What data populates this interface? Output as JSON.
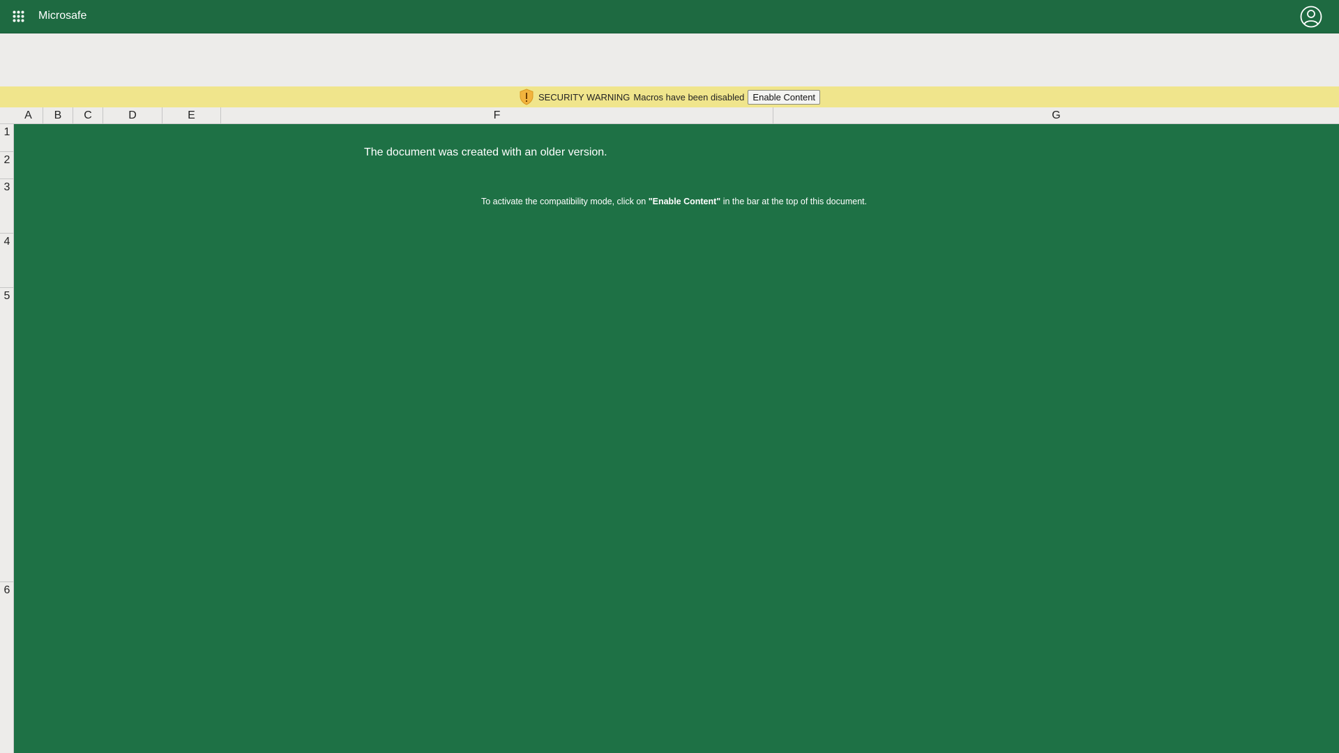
{
  "topbar": {
    "app_name": "Microsafe",
    "apps_icon": "app-launcher-icon",
    "account_icon": "account-icon"
  },
  "security_bar": {
    "label": "SECURITY WARNING",
    "message": "Macros have been disabled",
    "button_label": "Enable Content",
    "icon": "shield-warning-icon"
  },
  "columns": [
    "A",
    "B",
    "C",
    "D",
    "E",
    "F",
    "G"
  ],
  "rows": [
    "1",
    "2",
    "3",
    "4",
    "5",
    "6"
  ],
  "sheet": {
    "headline": "The document was created with an older version.",
    "instruction_before": "To activate the compatibility mode, click on ",
    "instruction_bold": "\"Enable Content\"",
    "instruction_after": " in the bar at the top of this document."
  },
  "colors": {
    "header_green": "#1e6a41",
    "sheet_green": "#1e7145",
    "warning_yellow": "#f0e58c",
    "ribbon_gray": "#edecea"
  }
}
